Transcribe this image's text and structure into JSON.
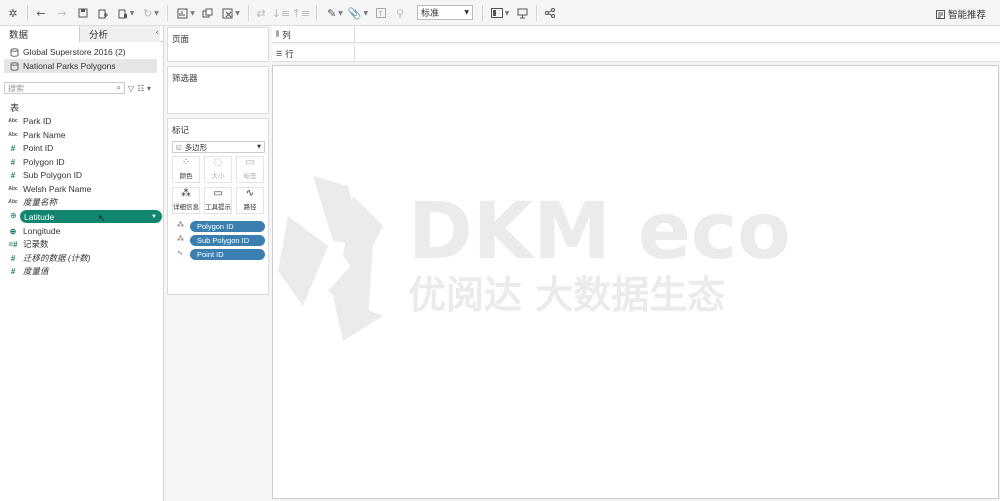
{
  "toolbar": {
    "fit_value": "标准",
    "smart_label": "智能推荐"
  },
  "left": {
    "tab_data": "数据",
    "tab_analysis": "分析",
    "collapse": "‹",
    "datasources": [
      "Global Superstore 2016 (2)",
      "National Parks Polygons"
    ],
    "search_placeholder": "搜索",
    "table_label": "表",
    "fields": [
      {
        "icon": "Abc",
        "name": "Park ID"
      },
      {
        "icon": "Abc",
        "name": "Park Name"
      },
      {
        "icon": "#",
        "name": "Point ID"
      },
      {
        "icon": "#",
        "name": "Polygon ID"
      },
      {
        "icon": "#",
        "name": "Sub Polygon ID"
      },
      {
        "icon": "Abc",
        "name": "Welsh Park Name"
      },
      {
        "icon": "Abc",
        "name": "度量名称"
      }
    ],
    "latitude": "Latitude",
    "fields2": [
      {
        "name": "Longitude"
      },
      {
        "name": "记录数"
      },
      {
        "name": "迁移的数据 (计数)"
      },
      {
        "name": "度量值"
      }
    ]
  },
  "cards": {
    "pages": "页面",
    "filters": "筛选器",
    "marks": "标记",
    "mark_type": "多边形",
    "buttons": [
      "颜色",
      "大小",
      "标签",
      "详细信息",
      "工具提示",
      "路径"
    ],
    "pills": [
      "Polygon ID",
      "Sub Polygon ID",
      "Point ID"
    ]
  },
  "shelves": {
    "columns": "列",
    "rows": "行"
  },
  "watermark": {
    "brand": "DKM eco",
    "tagline": "优阅达 大数据生态"
  }
}
